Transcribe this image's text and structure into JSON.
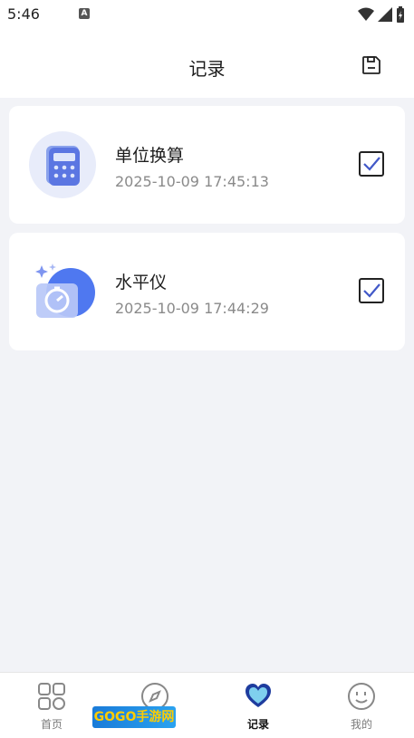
{
  "status": {
    "time": "5:46",
    "badge": "A"
  },
  "header": {
    "title": "记录"
  },
  "records": [
    {
      "title": "单位换算",
      "time": "2025-10-09 17:45:13",
      "checked": true
    },
    {
      "title": "水平仪",
      "time": "2025-10-09 17:44:29",
      "checked": true
    }
  ],
  "tabs": [
    {
      "label": "首页",
      "icon": "grid-icon"
    },
    {
      "label": "",
      "icon": "compass-icon"
    },
    {
      "label": "记录",
      "icon": "heart-icon",
      "active": true
    },
    {
      "label": "我的",
      "icon": "smile-icon"
    }
  ],
  "watermark": {
    "text": "GOGO手游网"
  },
  "colors": {
    "accent": "#4f78f0",
    "background": "#f2f3f7"
  }
}
